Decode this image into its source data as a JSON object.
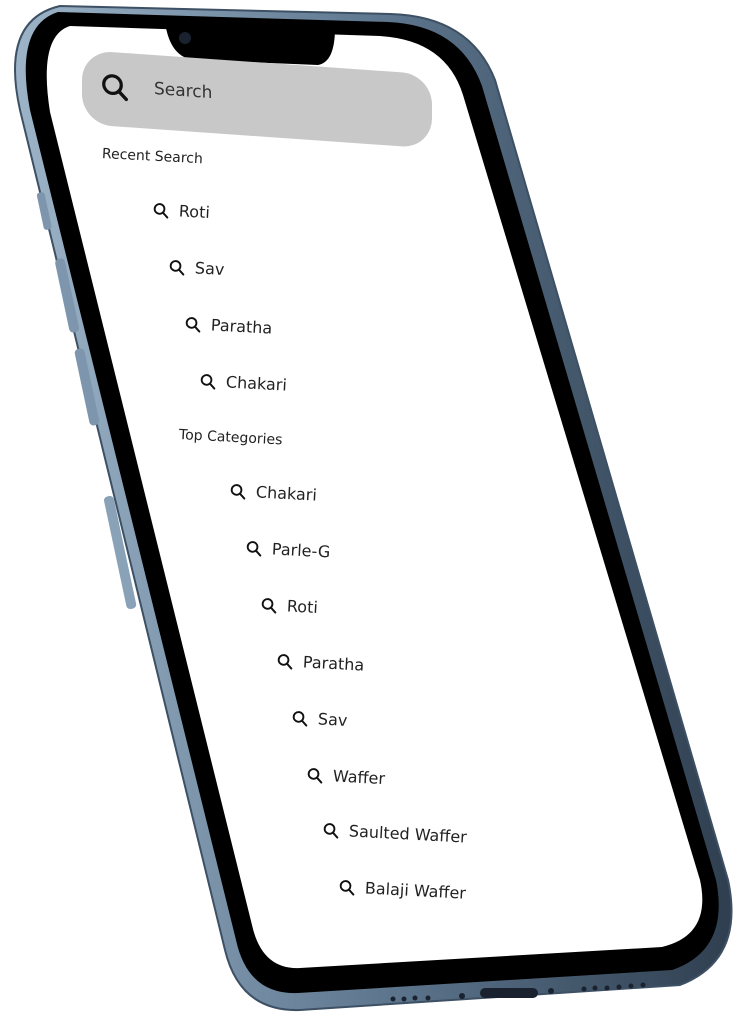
{
  "search": {
    "placeholder": "Search",
    "icon": "search-icon"
  },
  "recent": {
    "title": "Recent Search",
    "items": [
      "Roti",
      "Sav",
      "Paratha",
      "Chakari"
    ]
  },
  "categories": {
    "title": "Top Categories",
    "items": [
      "Chakari",
      "Parle-G",
      "Roti",
      "Paratha",
      "Sav",
      "Waffer",
      "Saulted Waffer",
      "Balaji Waffer"
    ]
  },
  "colors": {
    "screen": "#ffffff",
    "bezel": "#000000",
    "frame": "#6f8aa2",
    "search_bar": "#c8c8c8",
    "text": "#222222"
  }
}
